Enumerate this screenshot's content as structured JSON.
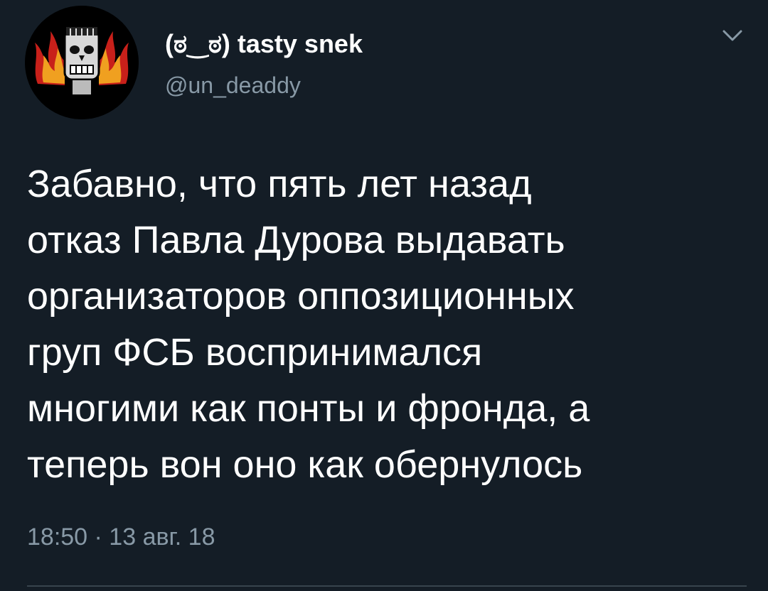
{
  "author": {
    "display_name": "(ಠ‿ಠ) tasty snek",
    "handle": "@un_deaddy",
    "avatar_icon": "skull-flames-avatar"
  },
  "tweet": {
    "text_lines": [
      "Забавно, что пять лет назад",
      "отказ Павла Дурова выдавать",
      "организаторов оппозиционных",
      "груп ФСБ воспринимался",
      "многими как понты и фронда, а",
      "теперь вон оно как обернулось"
    ],
    "timestamp": "18:50 · 13 авг. 18"
  },
  "menu": {
    "icon": "chevron-down-icon"
  },
  "colors": {
    "background": "#141d26",
    "text": "#ffffff",
    "secondary_text": "#8899a6",
    "divider": "#38444d"
  }
}
